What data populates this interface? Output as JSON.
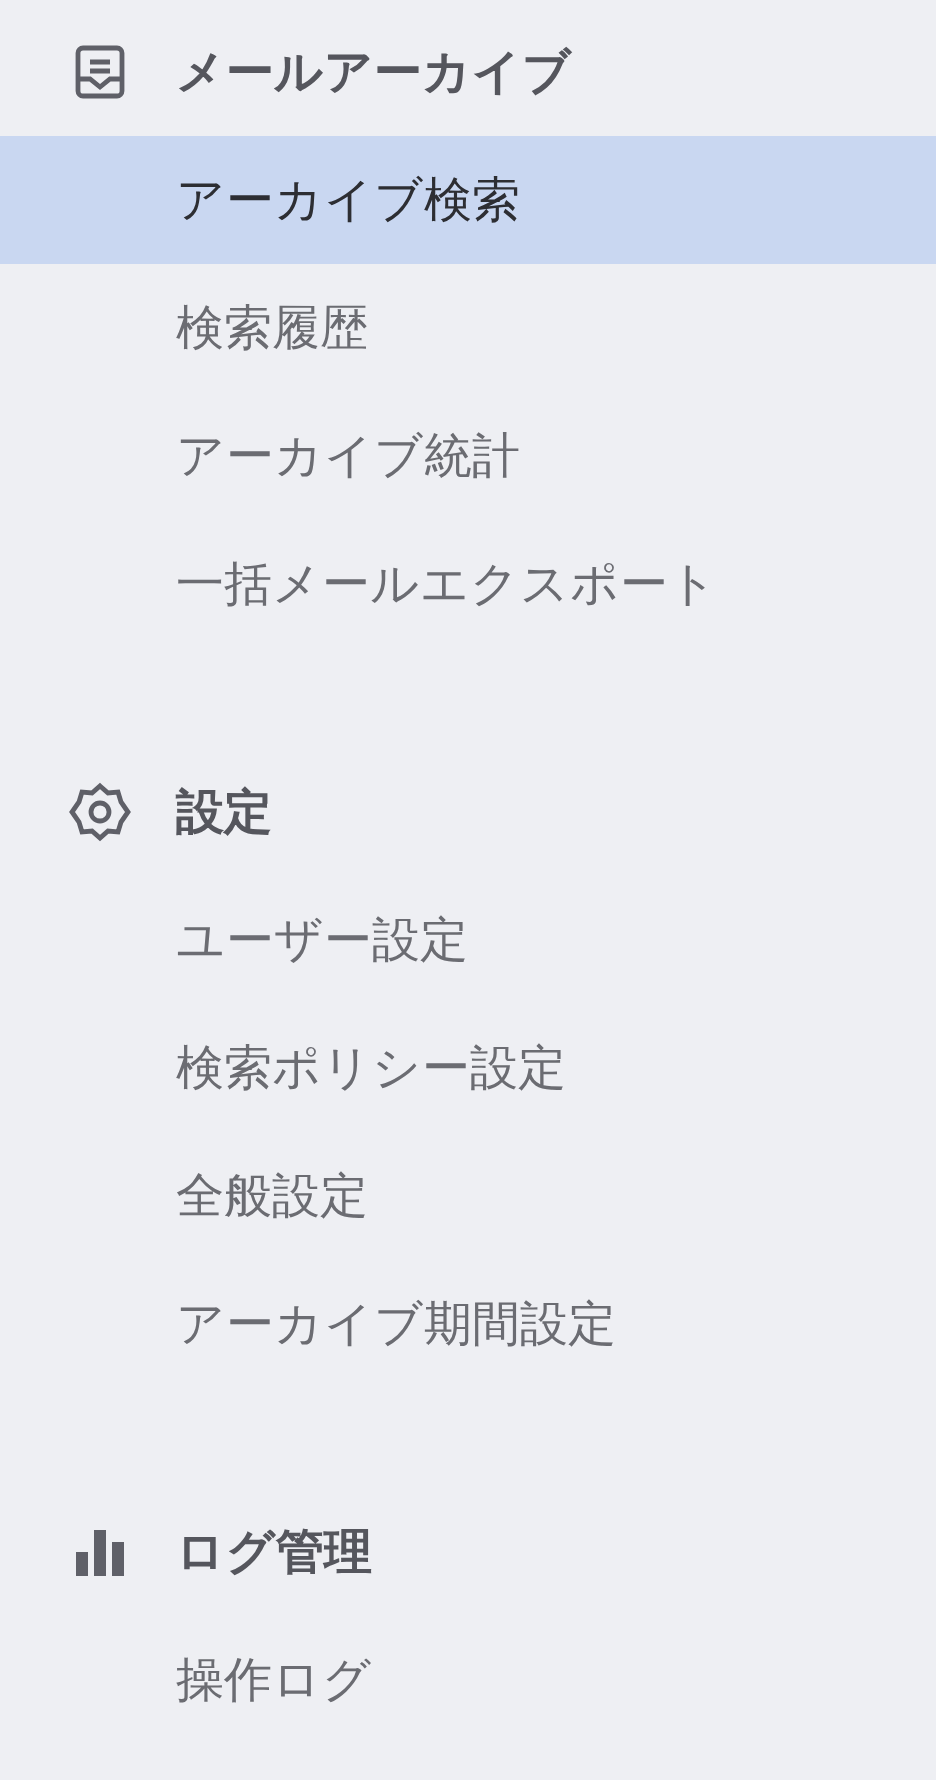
{
  "sections": [
    {
      "kind": "inbox",
      "title": "メールアーカイブ",
      "items": [
        {
          "label": "アーカイブ検索",
          "selected": true
        },
        {
          "label": "検索履歴",
          "selected": false
        },
        {
          "label": "アーカイブ統計",
          "selected": false
        },
        {
          "label": "一括メールエクスポート",
          "selected": false
        }
      ]
    },
    {
      "kind": "settings",
      "title": "設定",
      "items": [
        {
          "label": "ユーザー設定",
          "selected": false
        },
        {
          "label": "検索ポリシー設定",
          "selected": false
        },
        {
          "label": "全般設定",
          "selected": false
        },
        {
          "label": "アーカイブ期間設定",
          "selected": false
        }
      ]
    },
    {
      "kind": "chart",
      "title": "ログ管理",
      "items": [
        {
          "label": "操作ログ",
          "selected": false
        }
      ]
    }
  ]
}
